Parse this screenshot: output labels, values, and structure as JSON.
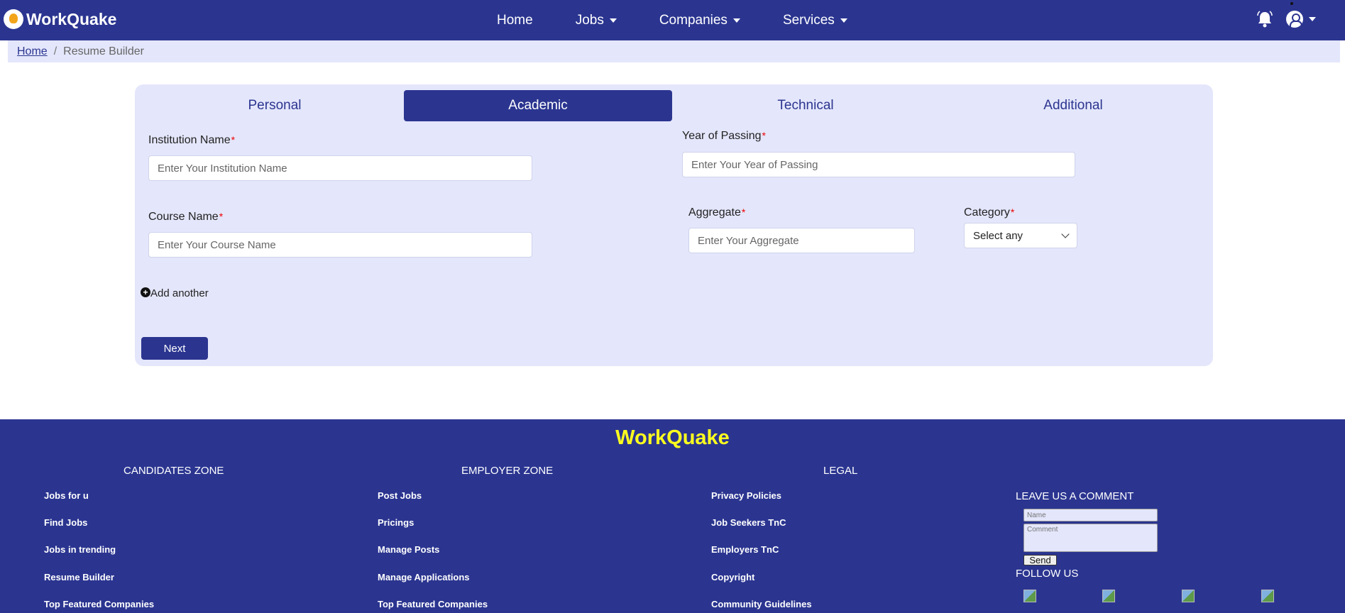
{
  "navbar": {
    "brand": "WorkQuake",
    "links": [
      "Home",
      "Jobs",
      "Companies",
      "Services"
    ]
  },
  "breadcrumb": {
    "home": "Home",
    "separator": "/",
    "current": "Resume Builder"
  },
  "form": {
    "tabs": [
      "Personal",
      "Academic",
      "Technical",
      "Additional"
    ],
    "active_tab": "Academic",
    "institution": {
      "label": "Institution Name",
      "placeholder": "Enter Your Institution Name"
    },
    "year": {
      "label": "Year of Passing",
      "placeholder": "Enter Your Year of Passing"
    },
    "course": {
      "label": "Course Name",
      "placeholder": "Enter Your Course Name"
    },
    "aggregate": {
      "label": "Aggregate",
      "placeholder": "Enter Your Aggregate"
    },
    "category": {
      "label": "Category",
      "value": "Select any"
    },
    "required_mark": "*",
    "add_another": "Add another",
    "next": "Next"
  },
  "footer": {
    "brand": "WorkQuake",
    "candidates": {
      "title": "CANDIDATES ZONE",
      "links": [
        "Jobs for u",
        "Find Jobs",
        "Jobs in trending",
        "Resume Builder",
        "Top Featured Companies"
      ]
    },
    "employer": {
      "title": "EMPLOYER ZONE",
      "links": [
        "Post Jobs",
        "Pricings",
        "Manage Posts",
        "Manage Applications",
        "Top Featured Companies"
      ]
    },
    "legal": {
      "title": "LEGAL",
      "links": [
        "Privacy Policies",
        "Job Seekers TnC",
        "Employers TnC",
        "Copyright",
        "Community Guidelines"
      ]
    },
    "comment": {
      "title": "LEAVE US A COMMENT",
      "name_placeholder": "Name",
      "comment_placeholder": "Comment",
      "send": "Send"
    },
    "follow_title": "FOLLOW US"
  },
  "colors": {
    "primary": "#2b3590",
    "panel": "#e4e6fb",
    "footer_brand": "#ffff1f",
    "required": "#e00000"
  }
}
